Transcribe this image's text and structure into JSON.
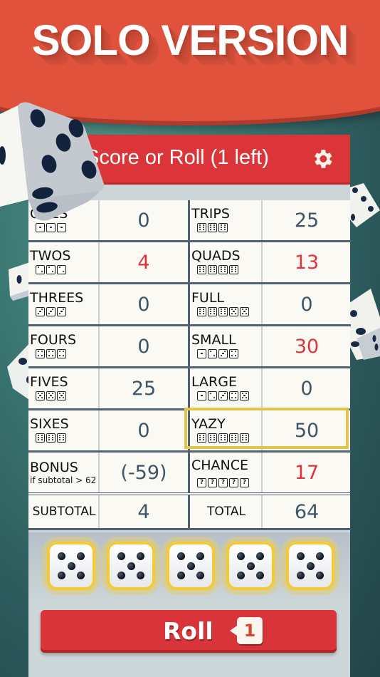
{
  "banner": {
    "title": "SOLO VERSION"
  },
  "header": {
    "title": "Score or Roll (1 left)",
    "settings_icon": "gear-icon"
  },
  "colors": {
    "banner": "#e0523c",
    "header": "#dc3539",
    "highlight": "#e0343a",
    "selected_frame": "#e2c54c",
    "die_border": "#f4cb36",
    "value_text": "#3e5566"
  },
  "scorecard": {
    "rows": [
      {
        "left": {
          "label": "ONES",
          "dice": [
            1,
            1,
            1
          ],
          "value": "0",
          "highlight": false
        },
        "right": {
          "label": "TRIPS",
          "dice": [
            6,
            6,
            6
          ],
          "value": "25",
          "highlight": false
        }
      },
      {
        "left": {
          "label": "TWOS",
          "dice": [
            2,
            2,
            2
          ],
          "value": "4",
          "highlight": true
        },
        "right": {
          "label": "QUADS",
          "dice": [
            6,
            6,
            6,
            6
          ],
          "value": "13",
          "highlight": true
        }
      },
      {
        "left": {
          "label": "THREES",
          "dice": [
            3,
            3,
            3
          ],
          "value": "0",
          "highlight": false
        },
        "right": {
          "label": "FULL",
          "dice": [
            6,
            6,
            6,
            5,
            5
          ],
          "value": "0",
          "highlight": false
        }
      },
      {
        "left": {
          "label": "FOURS",
          "dice": [
            4,
            4,
            4
          ],
          "value": "0",
          "highlight": false
        },
        "right": {
          "label": "SMALL",
          "dice": [
            1,
            2,
            3,
            4
          ],
          "value": "30",
          "highlight": true
        }
      },
      {
        "left": {
          "label": "FIVES",
          "dice": [
            5,
            5,
            5
          ],
          "value": "25",
          "highlight": false
        },
        "right": {
          "label": "LARGE",
          "dice": [
            1,
            2,
            3,
            4,
            5
          ],
          "value": "0",
          "highlight": false
        }
      },
      {
        "left": {
          "label": "SIXES",
          "dice": [
            6,
            6,
            6
          ],
          "value": "0",
          "highlight": false
        },
        "right": {
          "label": "YAZY",
          "dice": [
            6,
            6,
            6,
            6,
            6
          ],
          "value": "50",
          "highlight": false,
          "selected": true
        }
      },
      {
        "left": {
          "label": "BONUS",
          "sublabel": "if subtotal > 62",
          "value": "(-59)",
          "highlight": false
        },
        "right": {
          "label": "CHANCE",
          "dice": [
            "?",
            "?",
            "?",
            "?",
            "?"
          ],
          "value": "17",
          "highlight": true
        }
      }
    ],
    "subtotal": {
      "label": "SUBTOTAL",
      "value": "4"
    },
    "total": {
      "label": "TOTAL",
      "value": "64"
    }
  },
  "dice": [
    {
      "value": 5,
      "held": true
    },
    {
      "value": 5,
      "held": true
    },
    {
      "value": 5,
      "held": true
    },
    {
      "value": 5,
      "held": true
    },
    {
      "value": 5,
      "held": true
    }
  ],
  "roll_button": {
    "label": "Roll",
    "rolls_left": "1"
  }
}
